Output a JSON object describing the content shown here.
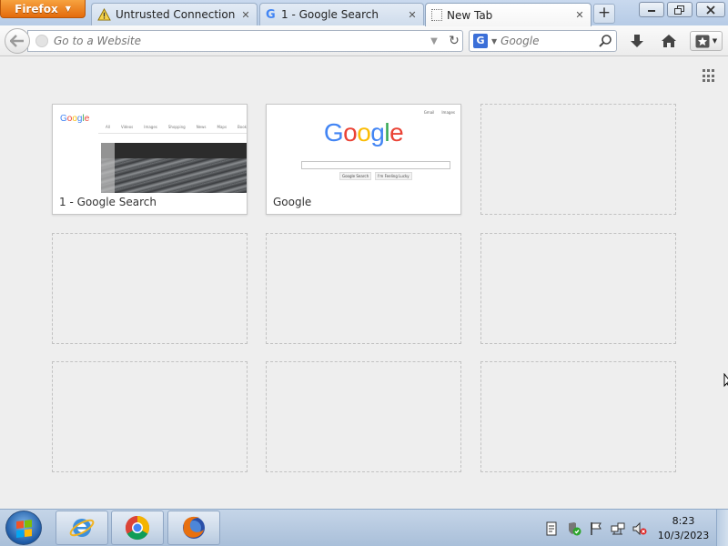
{
  "browser": {
    "menu_button": "Firefox",
    "tabs": [
      {
        "label": "Untrusted Connection",
        "icon": "warning-icon",
        "active": false
      },
      {
        "label": "1 - Google Search",
        "icon": "google-g-icon",
        "active": false
      },
      {
        "label": "New Tab",
        "icon": "blank-page-icon",
        "active": true
      }
    ],
    "new_tab_button": "+"
  },
  "toolbar": {
    "url_placeholder": "Go to a Website",
    "search_engine": "G",
    "search_placeholder": "Google"
  },
  "newtab": {
    "sites": [
      {
        "title": "1 - Google Search",
        "filled": true
      },
      {
        "title": "Google",
        "filled": true
      },
      {
        "title": "",
        "filled": false
      },
      {
        "title": "",
        "filled": false
      },
      {
        "title": "",
        "filled": false
      },
      {
        "title": "",
        "filled": false
      },
      {
        "title": "",
        "filled": false
      },
      {
        "title": "",
        "filled": false
      },
      {
        "title": "",
        "filled": false
      }
    ],
    "thumb_search": {
      "logo": "Google",
      "nav": [
        "All",
        "Videos",
        "Images",
        "Shopping",
        "News",
        "Maps",
        "Books"
      ]
    },
    "thumb_home": {
      "top_links": [
        "Gmail",
        "Images"
      ],
      "logo_letters": [
        {
          "ch": "G",
          "color": "#4285f4"
        },
        {
          "ch": "o",
          "color": "#ea4335"
        },
        {
          "ch": "o",
          "color": "#fbbc05"
        },
        {
          "ch": "g",
          "color": "#4285f4"
        },
        {
          "ch": "l",
          "color": "#34a853"
        },
        {
          "ch": "e",
          "color": "#ea4335"
        }
      ],
      "buttons": [
        "Google Search",
        "I'm Feeling Lucky"
      ]
    }
  },
  "taskbar": {
    "pinned": [
      "internet-explorer-icon",
      "chrome-icon",
      "firefox-icon"
    ],
    "clock": {
      "time": "8:23",
      "date": "10/3/2023"
    }
  },
  "colors": {
    "firefox_orange": "#e66f10",
    "tab_strip": "#c1d4ec",
    "taskbar": "#b7c9df"
  }
}
